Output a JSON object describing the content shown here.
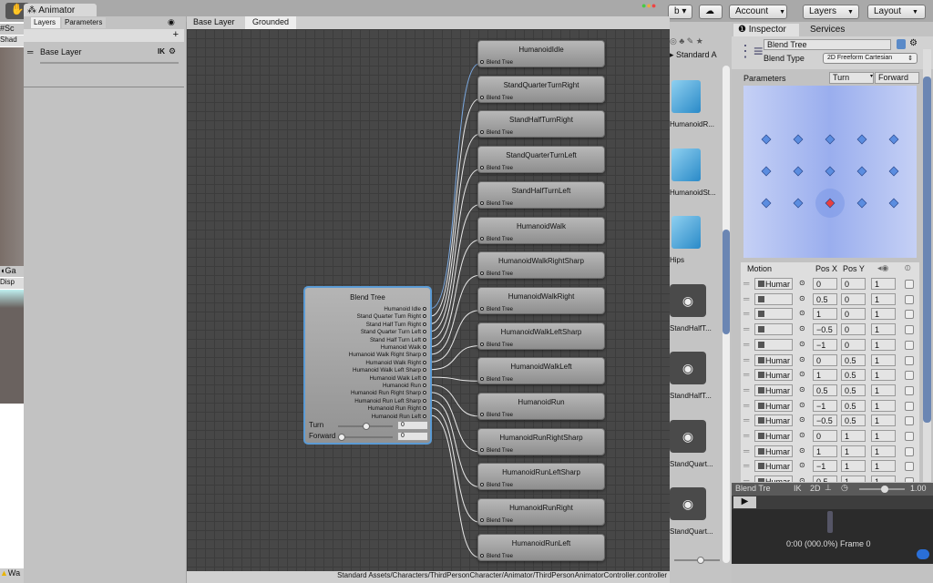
{
  "toolbar": {
    "collab": "b",
    "account": "Account",
    "layers": "Layers",
    "layout": "Layout"
  },
  "animator": {
    "tab": "Animator",
    "subtabs": [
      "Layers",
      "Parameters"
    ],
    "breadcrumb": [
      "Base Layer",
      "Grounded"
    ],
    "layer_name": "Base Layer",
    "ik": "IK",
    "status_path": "Standard Assets/Characters/ThirdPersonCharacter/Animator/ThirdPersonAnimatorController.controller"
  },
  "left_panels": {
    "scene_tab": "Sc",
    "scene_sub": "Shad",
    "game_tab": "Ga",
    "game_sub": "Disp",
    "warning": "Wa"
  },
  "nodes": [
    "HumanoidIdle",
    "StandQuarterTurnRight",
    "StandHalfTurnRight",
    "StandQuarterTurnLeft",
    "StandHalfTurnLeft",
    "HumanoidWalk",
    "HumanoidWalkRightSharp",
    "HumanoidWalkRight",
    "HumanoidWalkLeftSharp",
    "HumanoidWalkLeft",
    "HumanoidRun",
    "HumanoidRunRightSharp",
    "HumanoidRunLeftSharp",
    "HumanoidRunRight",
    "HumanoidRunLeft"
  ],
  "node_sub": "Blend Tree",
  "blend_node": {
    "title": "Blend Tree",
    "outputs": [
      "Humanoid Idle",
      "Stand Quarter Turn Right",
      "Stand Half Turn Right",
      "Stand Quarter Turn Left",
      "Stand Half Turn Left",
      "Humanoid Walk",
      "Humanoid Walk Right Sharp",
      "Humanoid Walk Right",
      "Humanoid Walk Left Sharp",
      "Humanoid Walk Left",
      "Humanoid Run",
      "Humanoid Run Right Sharp",
      "Humanoid Run Left Sharp",
      "Humanoid Run Right",
      "Humanoid Run Left"
    ],
    "params": [
      {
        "name": "Turn",
        "value": "0",
        "slider": 0.5
      },
      {
        "name": "Forward",
        "value": "0",
        "slider": 0
      }
    ]
  },
  "project": {
    "breadcrumb": "Standard A",
    "items": [
      "HumanoidR...",
      "HumanoidSt...",
      "Hips",
      "StandHalfT...",
      "StandHalfT...",
      "StandQuart...",
      "StandQuart..."
    ]
  },
  "inspector": {
    "tabs": [
      "Inspector",
      "Services"
    ],
    "name": "Blend Tree",
    "blend_type_label": "Blend Type",
    "blend_type": "2D Freeform Cartesian",
    "parameters_label": "Parameters",
    "param_x": "Turn",
    "param_y": "Forward",
    "columns": [
      "Motion",
      "Pos X",
      "Pos Y"
    ],
    "motions": [
      {
        "name": "Humar",
        "x": "0",
        "y": "0",
        "speed": "1"
      },
      {
        "name": "StandC",
        "x": "0.5",
        "y": "0",
        "speed": "1"
      },
      {
        "name": "StandH",
        "x": "1",
        "y": "0",
        "speed": "1"
      },
      {
        "name": "StandC",
        "x": "−0.5",
        "y": "0",
        "speed": "1"
      },
      {
        "name": "StandH",
        "x": "−1",
        "y": "0",
        "speed": "1"
      },
      {
        "name": "Humar",
        "x": "0",
        "y": "0.5",
        "speed": "1"
      },
      {
        "name": "Humar",
        "x": "1",
        "y": "0.5",
        "speed": "1"
      },
      {
        "name": "Humar",
        "x": "0.5",
        "y": "0.5",
        "speed": "1"
      },
      {
        "name": "Humar",
        "x": "−1",
        "y": "0.5",
        "speed": "1"
      },
      {
        "name": "Humar",
        "x": "−0.5",
        "y": "0.5",
        "speed": "1"
      },
      {
        "name": "Humar",
        "x": "0",
        "y": "1",
        "speed": "1"
      },
      {
        "name": "Humar",
        "x": "1",
        "y": "1",
        "speed": "1"
      },
      {
        "name": "Humar",
        "x": "−1",
        "y": "1",
        "speed": "1"
      },
      {
        "name": "Humar",
        "x": "0.5",
        "y": "1",
        "speed": "1"
      }
    ],
    "extra_point": {
      "x": -0.5,
      "y": 1
    },
    "preview": {
      "title": "Blend Tre",
      "ik": "IK",
      "mode": "2D",
      "speed": "1.00",
      "time": "0:00 (000.0%) Frame 0"
    }
  },
  "colors": {
    "accent": "#5b9bd5",
    "graph_bg": "#474747",
    "blend_bg": "#a8b8f0",
    "selected": "#e84040"
  }
}
